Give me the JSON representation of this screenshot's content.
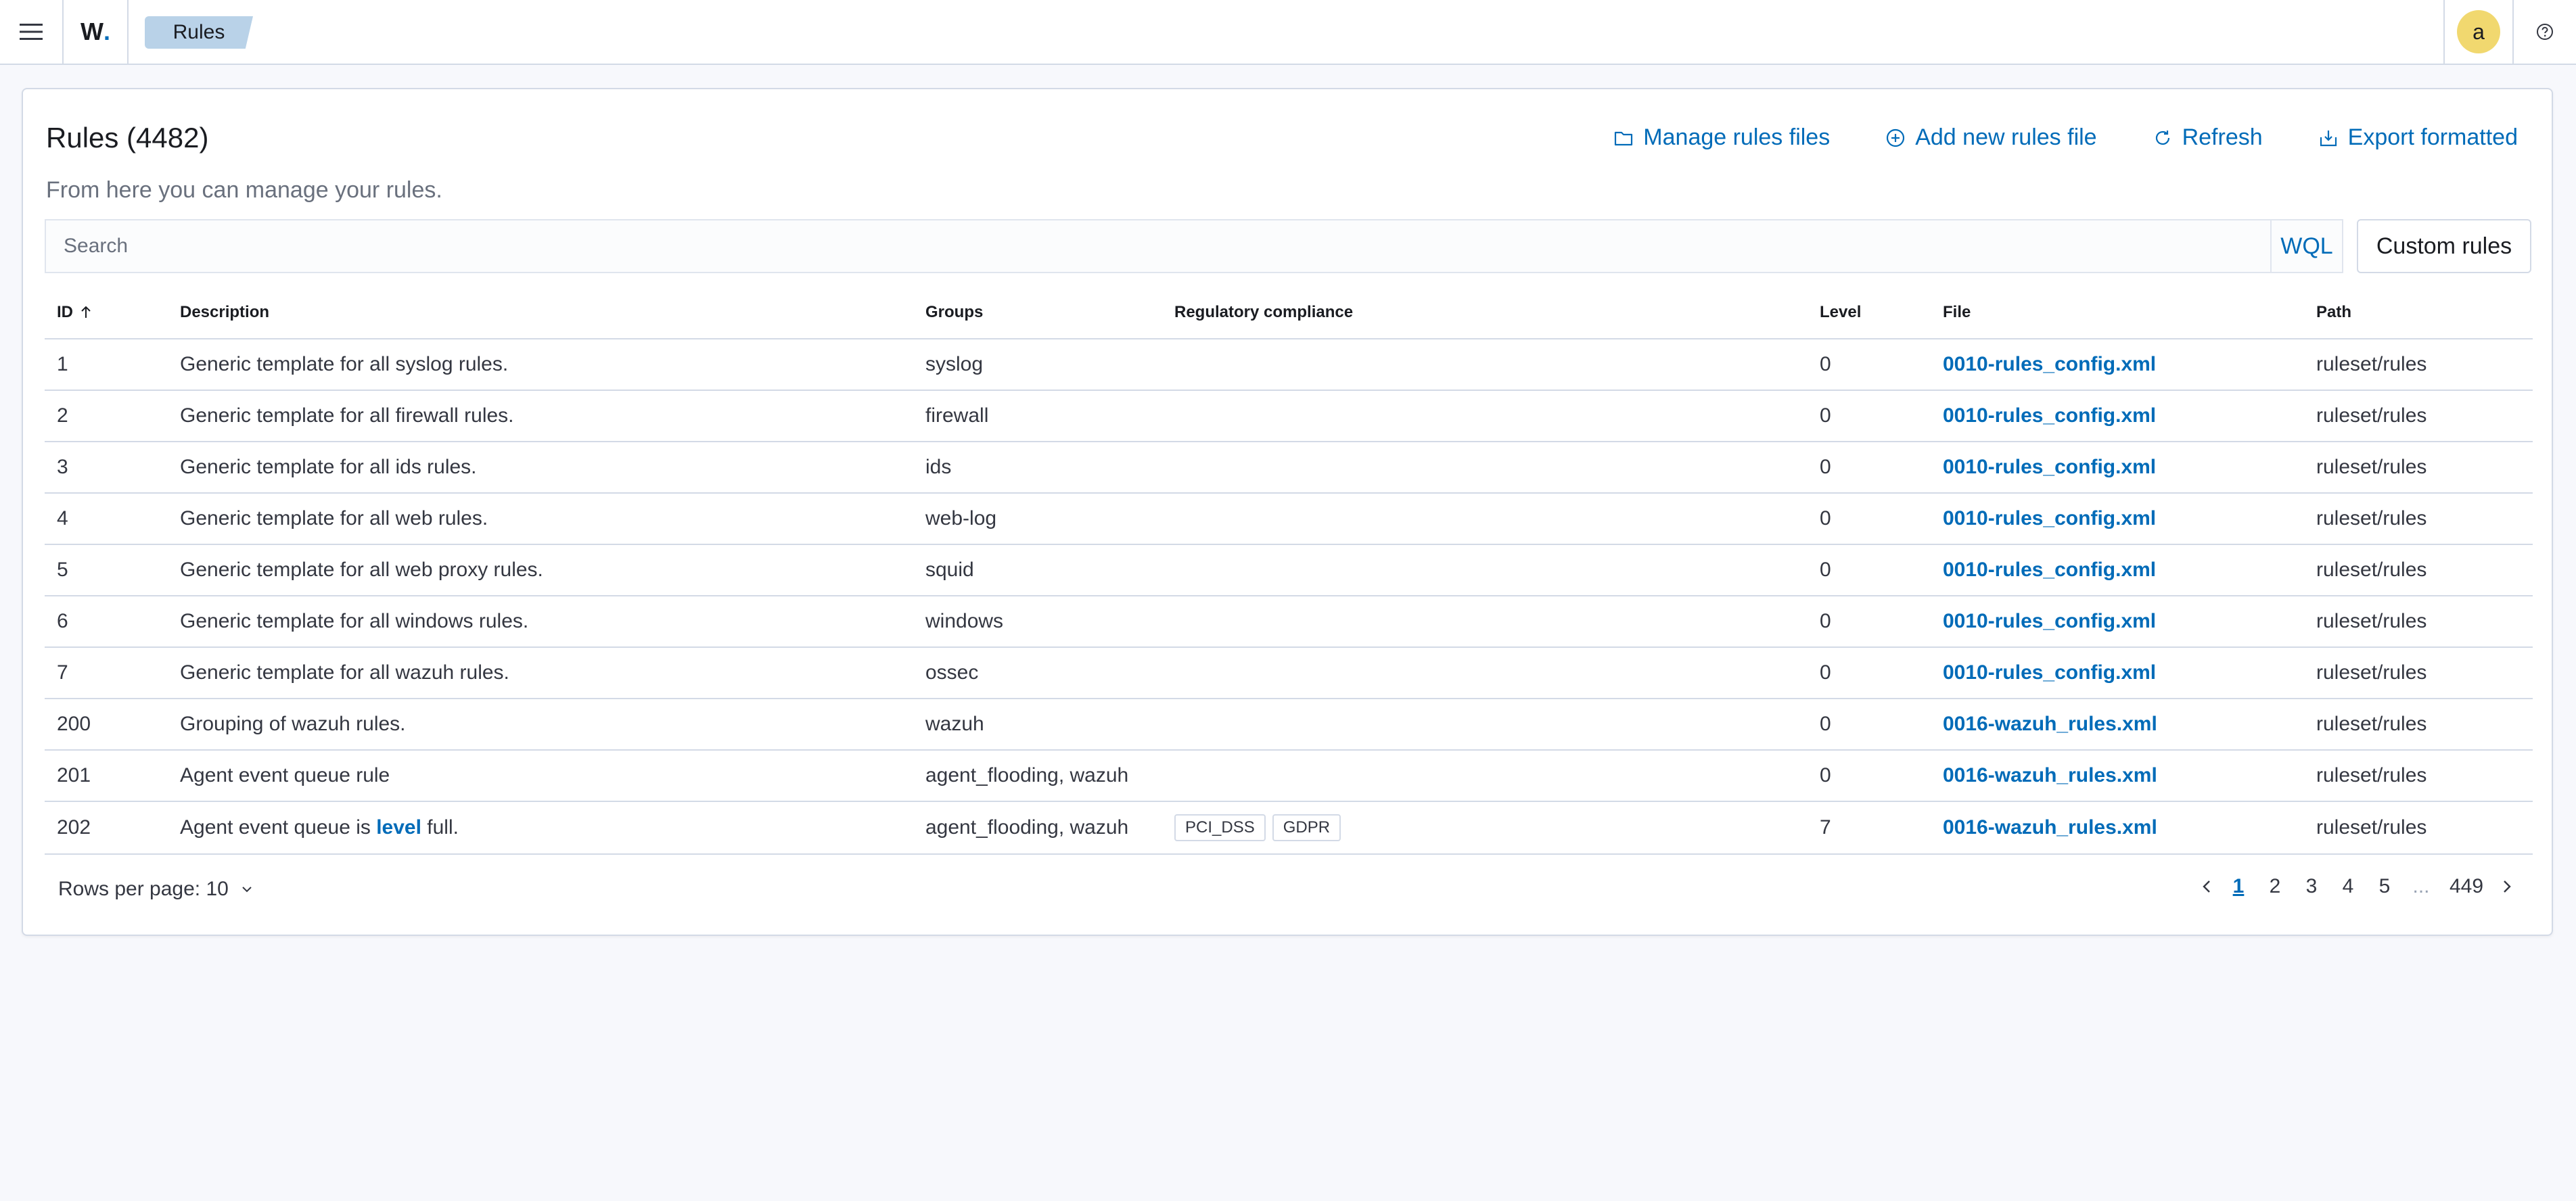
{
  "header": {
    "logo_text": "W",
    "logo_dot": ".",
    "breadcrumb": "Rules",
    "avatar_initial": "a",
    "menu_icon": "hamburger-menu-icon",
    "help_icon": "help-icon"
  },
  "page": {
    "title": "Rules (4482)",
    "subtitle": "From here you can manage your rules.",
    "actions": {
      "manage": "Manage rules files",
      "add": "Add new rules file",
      "refresh": "Refresh",
      "export": "Export formatted"
    },
    "search": {
      "placeholder": "Search",
      "wql": "WQL"
    },
    "custom_rules": "Custom rules"
  },
  "table": {
    "columns": {
      "id": "ID",
      "description": "Description",
      "groups": "Groups",
      "compliance": "Regulatory compliance",
      "level": "Level",
      "file": "File",
      "path": "Path"
    },
    "sort": {
      "column": "ID",
      "direction": "ascending"
    },
    "rows": [
      {
        "id": "1",
        "description": "Generic template for all syslog rules.",
        "groups": "syslog",
        "level": "0",
        "file": "0010-rules_config.xml",
        "path": "ruleset/rules"
      },
      {
        "id": "2",
        "description": "Generic template for all firewall rules.",
        "groups": "firewall",
        "level": "0",
        "file": "0010-rules_config.xml",
        "path": "ruleset/rules"
      },
      {
        "id": "3",
        "description": "Generic template for all ids rules.",
        "groups": "ids",
        "level": "0",
        "file": "0010-rules_config.xml",
        "path": "ruleset/rules"
      },
      {
        "id": "4",
        "description": "Generic template for all web rules.",
        "groups": "web-log",
        "level": "0",
        "file": "0010-rules_config.xml",
        "path": "ruleset/rules"
      },
      {
        "id": "5",
        "description": "Generic template for all web proxy rules.",
        "groups": "squid",
        "level": "0",
        "file": "0010-rules_config.xml",
        "path": "ruleset/rules"
      },
      {
        "id": "6",
        "description": "Generic template for all windows rules.",
        "groups": "windows",
        "level": "0",
        "file": "0010-rules_config.xml",
        "path": "ruleset/rules"
      },
      {
        "id": "7",
        "description": "Generic template for all wazuh rules.",
        "groups": "ossec",
        "level": "0",
        "file": "0010-rules_config.xml",
        "path": "ruleset/rules"
      },
      {
        "id": "200",
        "description": "Grouping of wazuh rules.",
        "groups": "wazuh",
        "level": "0",
        "file": "0016-wazuh_rules.xml",
        "path": "ruleset/rules"
      },
      {
        "id": "201",
        "description": "Agent event queue rule",
        "groups": "agent_flooding, wazuh",
        "level": "0",
        "file": "0016-wazuh_rules.xml",
        "path": "ruleset/rules"
      },
      {
        "id": "202",
        "description_prefix": "Agent event queue is ",
        "description_keyword": "level",
        "description_suffix": " full.",
        "groups": "agent_flooding, wazuh",
        "compliance": [
          "PCI_DSS",
          "GDPR"
        ],
        "level": "7",
        "file": "0016-wazuh_rules.xml",
        "path": "ruleset/rules"
      }
    ]
  },
  "footer": {
    "rows_per_page": "Rows per page: 10",
    "pages": [
      "1",
      "2",
      "3",
      "4",
      "5",
      "...",
      "449"
    ],
    "current_page": "1"
  }
}
